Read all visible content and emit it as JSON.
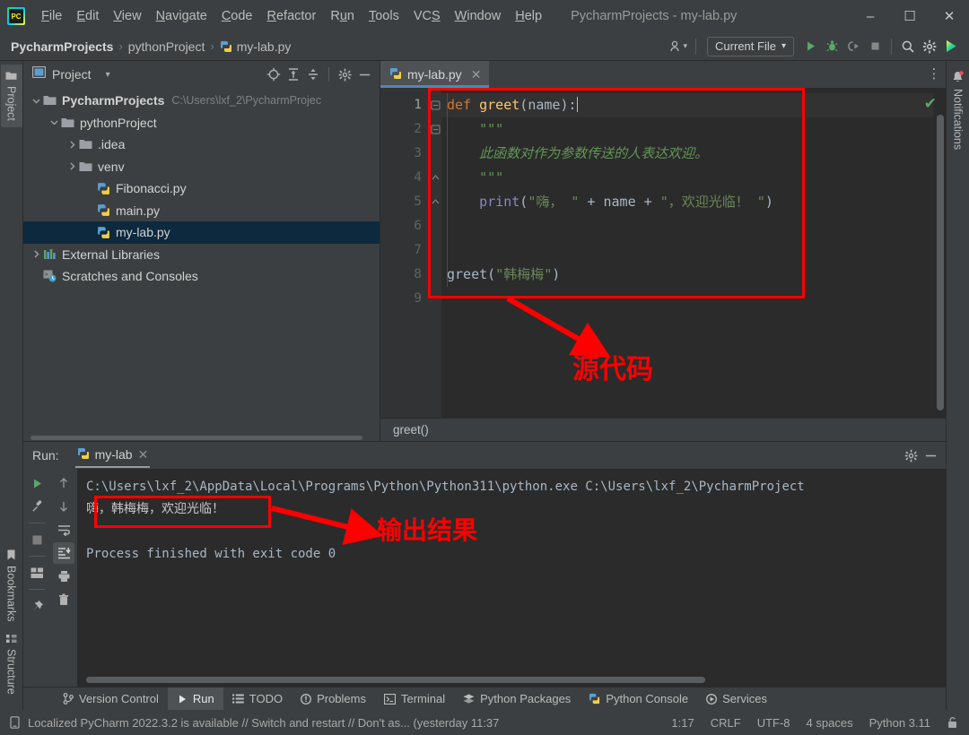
{
  "window": {
    "title": "PycharmProjects - my-lab.py",
    "minimize": "–",
    "maximize": "☐",
    "close": "✕"
  },
  "menu": [
    {
      "label": "File",
      "mnemonic": "F"
    },
    {
      "label": "Edit",
      "mnemonic": "E"
    },
    {
      "label": "View",
      "mnemonic": "V"
    },
    {
      "label": "Navigate",
      "mnemonic": "N"
    },
    {
      "label": "Code",
      "mnemonic": "C"
    },
    {
      "label": "Refactor",
      "mnemonic": "R"
    },
    {
      "label": "Run",
      "mnemonic": "u"
    },
    {
      "label": "Tools",
      "mnemonic": "T"
    },
    {
      "label": "VCS",
      "mnemonic": "S"
    },
    {
      "label": "Window",
      "mnemonic": "W"
    },
    {
      "label": "Help",
      "mnemonic": "H"
    }
  ],
  "navbar": {
    "breadcrumbs": [
      "PycharmProjects",
      "pythonProject",
      "my-lab.py"
    ],
    "separator": "›",
    "run_config": "Current File",
    "dropdown_caret": "▾"
  },
  "left_rail": [
    {
      "label": "Project",
      "icon": "folder-icon",
      "active": true
    },
    {
      "label": "Structure",
      "icon": "structure-icon",
      "active": false
    },
    {
      "label": "Bookmarks",
      "icon": "bookmark-icon",
      "active": false
    }
  ],
  "right_rail": [
    {
      "label": "Notifications",
      "icon": "bell-icon"
    }
  ],
  "project_panel": {
    "title": "Project",
    "caret": "▾",
    "tree": [
      {
        "name": "PycharmProjects",
        "path": "C:\\Users\\lxf_2\\PycharmProjec",
        "icon": "folder-icon",
        "depth": 0,
        "twist": "⌄",
        "bold": true,
        "selected": false
      },
      {
        "name": "pythonProject",
        "path": "",
        "icon": "folder-icon",
        "depth": 1,
        "twist": "⌄",
        "bold": false,
        "selected": false
      },
      {
        "name": ".idea",
        "path": "",
        "icon": "folder-icon",
        "depth": 2,
        "twist": "›",
        "bold": false,
        "selected": false
      },
      {
        "name": "venv",
        "path": "",
        "icon": "folder-icon",
        "depth": 2,
        "twist": "›",
        "bold": false,
        "selected": false
      },
      {
        "name": "Fibonacci.py",
        "path": "",
        "icon": "python-file-icon",
        "depth": 3,
        "twist": "",
        "bold": false,
        "selected": false
      },
      {
        "name": "main.py",
        "path": "",
        "icon": "python-file-icon",
        "depth": 3,
        "twist": "",
        "bold": false,
        "selected": false
      },
      {
        "name": "my-lab.py",
        "path": "",
        "icon": "python-file-icon",
        "depth": 3,
        "twist": "",
        "bold": false,
        "selected": true
      },
      {
        "name": "External Libraries",
        "path": "",
        "icon": "libraries-icon",
        "depth": 0,
        "twist": "›",
        "bold": false,
        "selected": false
      },
      {
        "name": "Scratches and Consoles",
        "path": "",
        "icon": "scratches-icon",
        "depth": 0,
        "twist": "",
        "bold": false,
        "selected": false
      }
    ]
  },
  "editor": {
    "tab": {
      "label": "my-lab.py",
      "close": "✕",
      "icon": "python-file-icon"
    },
    "more": "⋮",
    "inspection_ok": "✔",
    "line_numbers": [
      "1",
      "2",
      "3",
      "4",
      "5",
      "6",
      "7",
      "8",
      "9"
    ],
    "breadcrumb": "greet()",
    "code": {
      "l1_kw": "def",
      "l1_fn": "greet",
      "l1_open": "(",
      "l1_param": "name",
      "l1_close": "):",
      "l2_quote": "\"\"\"",
      "l3_doc": "此函数对作为参数传送的人表达欢迎。",
      "l4_quote": "\"\"\"",
      "l5_fn": "print",
      "l5_open": "(",
      "l5_s1": "\"嗨， \"",
      "l5_plus1": " + ",
      "l5_name": "name",
      "l5_plus2": " + ",
      "l5_s2": "\"，欢迎光临！ \"",
      "l5_close": ")",
      "l8_fn": "greet",
      "l8_open": "(",
      "l8_arg": "\"韩梅梅\"",
      "l8_close": ")"
    }
  },
  "run_panel": {
    "label": "Run:",
    "tab": "my-lab",
    "tab_close": "✕",
    "console": {
      "command": "C:\\Users\\lxf_2\\AppData\\Local\\Programs\\Python\\Python311\\python.exe C:\\Users\\lxf_2\\PycharmProject",
      "output": "嗨，韩梅梅，欢迎光临！",
      "finished": "Process finished with exit code 0"
    }
  },
  "tool_tabs": [
    {
      "label": "Version Control",
      "icon": "branch-icon",
      "active": false
    },
    {
      "label": "Run",
      "icon": "play-icon",
      "active": true
    },
    {
      "label": "TODO",
      "icon": "list-icon",
      "active": false
    },
    {
      "label": "Problems",
      "icon": "warning-icon",
      "active": false
    },
    {
      "label": "Terminal",
      "icon": "terminal-icon",
      "active": false
    },
    {
      "label": "Python Packages",
      "icon": "packages-icon",
      "active": false
    },
    {
      "label": "Python Console",
      "icon": "python-icon",
      "active": false
    },
    {
      "label": "Services",
      "icon": "services-icon",
      "active": false
    }
  ],
  "statusbar": {
    "message": "Localized PyCharm 2022.3.2 is available // Switch and restart // Don't as... (yesterday 11:37",
    "caret_position": "1:17",
    "line_ending": "CRLF",
    "encoding": "UTF-8",
    "indent": "4 spaces",
    "interpreter": "Python 3.11"
  },
  "annotations": {
    "source_code_label": "源代码",
    "output_label": "输出结果"
  },
  "colors": {
    "accent_red": "#ff0000",
    "keyword_orange": "#cc7832",
    "function_yellow": "#ffc66d",
    "string_green": "#6a8759",
    "doc_green": "#629755",
    "builtin_violet": "#8888c6",
    "selection_blue": "#0d293e",
    "panel_bg": "#3c3f41",
    "editor_bg": "#2b2b2b"
  }
}
